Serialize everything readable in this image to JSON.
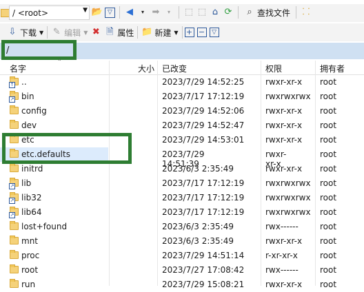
{
  "toolbar1": {
    "path_combo": "/ <root>",
    "find_files": "查找文件"
  },
  "toolbar2": {
    "download": "下载",
    "edit": "编辑",
    "properties": "属性",
    "new": "新建"
  },
  "pathbar": {
    "path": "/"
  },
  "columns": {
    "name": "名字",
    "size": "大小",
    "modified": "已改变",
    "rights": "权限",
    "owner": "拥有者"
  },
  "rows": [
    {
      "name": "..",
      "date": "2023/7/29 14:52:25",
      "perm": "rwxr-xr-x",
      "owner": "root",
      "type": "parent"
    },
    {
      "name": "bin",
      "date": "2023/7/17 17:12:19",
      "perm": "rwxrwxrwx",
      "owner": "root",
      "type": "link"
    },
    {
      "name": "config",
      "date": "2023/7/29 14:52:06",
      "perm": "rwxr-xr-x",
      "owner": "root",
      "type": "folder"
    },
    {
      "name": "dev",
      "date": "2023/7/29 14:52:47",
      "perm": "rwxr-xr-x",
      "owner": "root",
      "type": "folder"
    },
    {
      "name": "etc",
      "date": "2023/7/29 14:53:01",
      "perm": "rwxr-xr-x",
      "owner": "root",
      "type": "folder"
    },
    {
      "name": "etc.defaults",
      "date": "2023/7/29 14:51:39",
      "perm": "rwxr-xr-x",
      "owner": "root",
      "type": "folder"
    },
    {
      "name": "initrd",
      "date": "2023/6/3 2:35:49",
      "perm": "rwxr-xr-x",
      "owner": "root",
      "type": "folder"
    },
    {
      "name": "lib",
      "date": "2023/7/17 17:12:19",
      "perm": "rwxrwxrwx",
      "owner": "root",
      "type": "link"
    },
    {
      "name": "lib32",
      "date": "2023/7/17 17:12:19",
      "perm": "rwxrwxrwx",
      "owner": "root",
      "type": "link"
    },
    {
      "name": "lib64",
      "date": "2023/7/17 17:12:19",
      "perm": "rwxrwxrwx",
      "owner": "root",
      "type": "link"
    },
    {
      "name": "lost+found",
      "date": "2023/6/3 2:35:49",
      "perm": "rwx------",
      "owner": "root",
      "type": "folder"
    },
    {
      "name": "mnt",
      "date": "2023/6/3 2:35:49",
      "perm": "rwxr-xr-x",
      "owner": "root",
      "type": "folder"
    },
    {
      "name": "proc",
      "date": "2023/7/29 14:51:14",
      "perm": "r-xr-xr-x",
      "owner": "root",
      "type": "folder"
    },
    {
      "name": "root",
      "date": "2023/7/27 17:08:42",
      "perm": "rwx------",
      "owner": "root",
      "type": "folder"
    },
    {
      "name": "run",
      "date": "2023/7/29 15:08:21",
      "perm": "rwxr-xr-x",
      "owner": "root",
      "type": "folder"
    }
  ],
  "colors": {
    "highlight": "#2e7d32",
    "pathbar": "#cfe0f2",
    "selected": "#dcebfc"
  }
}
